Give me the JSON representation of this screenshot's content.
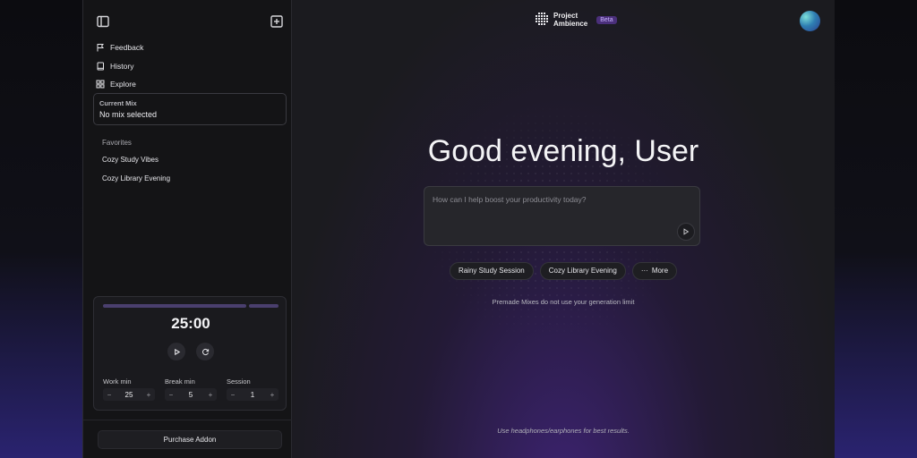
{
  "sidebar": {
    "nav": [
      {
        "label": "Feedback",
        "icon": "flag-icon"
      },
      {
        "label": "History",
        "icon": "book-icon"
      },
      {
        "label": "Explore",
        "icon": "grid-icon"
      }
    ],
    "current_mix": {
      "label": "Current Mix",
      "value": "No mix selected"
    },
    "favorites": {
      "title": "Favorites",
      "items": [
        "Cozy Study Vibes",
        "Cozy Library Evening"
      ]
    },
    "timer": {
      "display": "25:00",
      "work": {
        "label": "Work min",
        "value": "25"
      },
      "break": {
        "label": "Break min",
        "value": "5"
      },
      "session": {
        "label": "Session",
        "value": "1"
      }
    },
    "purchase_label": "Purchase Addon"
  },
  "header": {
    "brand_line1": "Project",
    "brand_line2": "Ambience",
    "badge": "Beta"
  },
  "main": {
    "greeting": "Good evening, User",
    "prompt_placeholder": "How can I help boost your productivity today?",
    "chips": [
      "Rainy Study Session",
      "Cozy Library Evening",
      "More"
    ],
    "note": "Premade Mixes do not use your generation limit",
    "footer": "Use headphones/earphones for best results."
  },
  "colors": {
    "accent": "#4a2f7a",
    "beta_text": "#c9b2ff",
    "background": "#1b1b1f"
  }
}
